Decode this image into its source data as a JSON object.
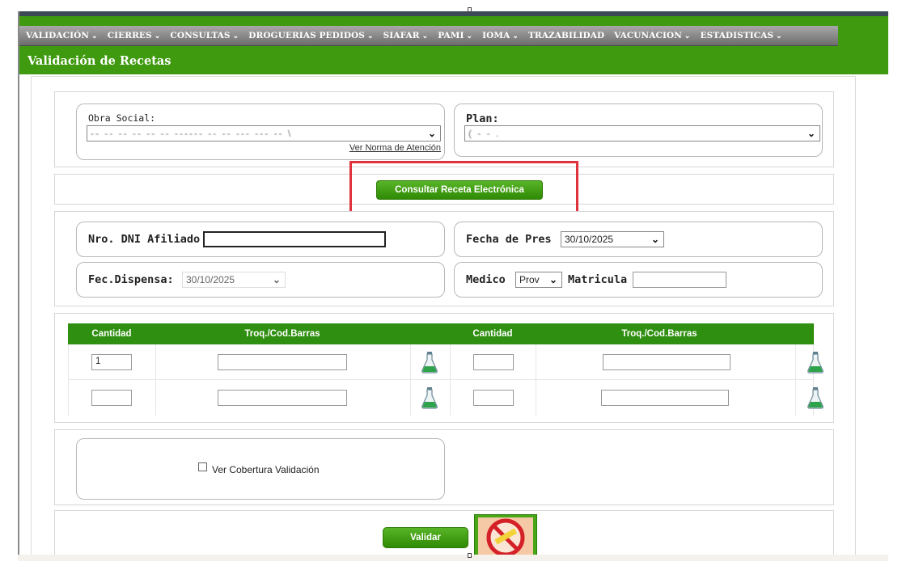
{
  "navbar": {
    "items": [
      {
        "label": "VALIDACIÓN",
        "dropdown": true
      },
      {
        "label": "CIERRES",
        "dropdown": true
      },
      {
        "label": "CONSULTAS",
        "dropdown": true
      },
      {
        "label": "DROGUERIAS PEDIDOS",
        "dropdown": true
      },
      {
        "label": "SIAFAR",
        "dropdown": true
      },
      {
        "label": "PAMI",
        "dropdown": true
      },
      {
        "label": "IOMA",
        "dropdown": true
      },
      {
        "label": "TRAZABILIDAD",
        "dropdown": false
      },
      {
        "label": "VACUNACION",
        "dropdown": true
      },
      {
        "label": "ESTADISTICAS",
        "dropdown": true
      }
    ],
    "arrow_glyph": "⌄"
  },
  "page": {
    "title": "Validación de Recetas"
  },
  "obra_social": {
    "label": "Obra Social:",
    "value": "-- -- -- -- -- -- ------ -- -- --- --- -- \\",
    "link": "Ver Norma de Atención"
  },
  "plan": {
    "label": "Plan:",
    "value": "(                    -  -                    ."
  },
  "actions": {
    "consultar_label": "Consultar Receta Electrónica",
    "validar_label": "Validar"
  },
  "afiliado": {
    "dni_label": "Nro. DNI Afiliado",
    "dni_value": "",
    "fecha_pres_label": "Fecha de Pres",
    "fecha_pres_value": "30/10/2025",
    "fec_dispensa_label": "Fec.Dispensa:",
    "fec_dispensa_value": "30/10/2025",
    "medico_label": "Medico",
    "medico_value": "Prov",
    "matricula_label": "Matricula",
    "matricula_value": ""
  },
  "grid": {
    "headers": [
      "Cantidad",
      "Troq./Cod.Barras",
      "Cantidad",
      "Troq./Cod.Barras"
    ],
    "rows": [
      {
        "cantidad_1": "1",
        "troq_1": "",
        "cantidad_2": "",
        "troq_2": ""
      },
      {
        "cantidad_1": "",
        "troq_1": "",
        "cantidad_2": "",
        "troq_2": ""
      }
    ]
  },
  "cobertura": {
    "label": "Ver Cobertura Validación",
    "checked": false
  },
  "colors": {
    "brand_green": "#3f9a0f",
    "highlight_red": "#e0323c",
    "nav_gray": "#8a8a8a"
  },
  "icons": {
    "flask": "flask-icon",
    "logo": "no-entry-logo-icon",
    "chevron": "chevron-down-icon"
  }
}
